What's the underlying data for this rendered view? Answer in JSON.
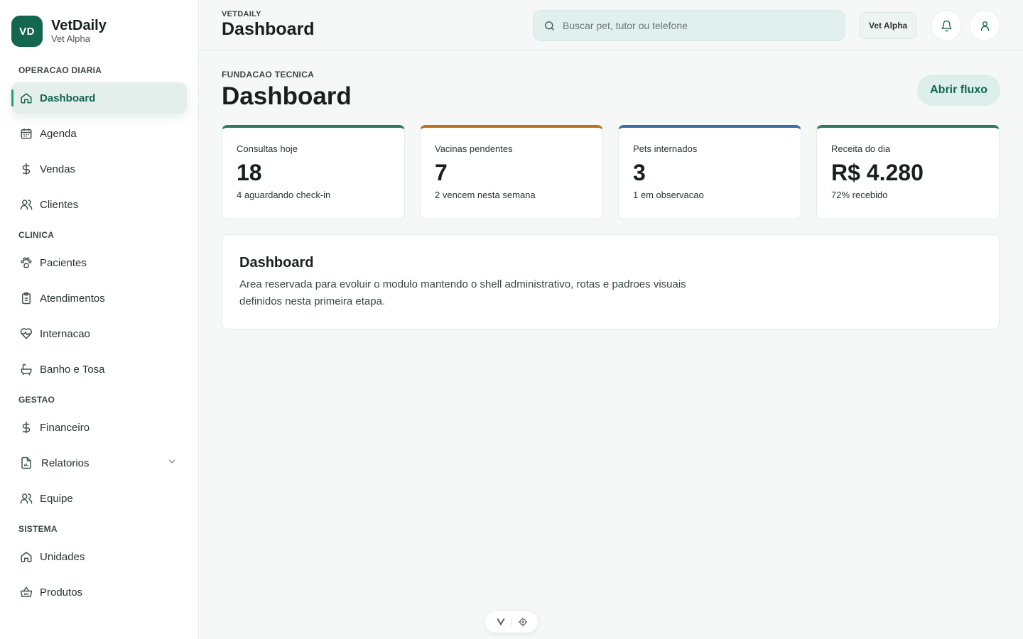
{
  "brand": {
    "initials": "VD",
    "name": "VetDaily",
    "unit": "Vet Alpha"
  },
  "sidebar": {
    "groups": [
      {
        "title": "OPERACAO DIARIA",
        "items": [
          {
            "label": "Dashboard",
            "icon": "home-icon"
          },
          {
            "label": "Agenda",
            "icon": "calendar-icon"
          },
          {
            "label": "Vendas",
            "icon": "dollar-icon"
          },
          {
            "label": "Clientes",
            "icon": "users-icon"
          }
        ]
      },
      {
        "title": "CLINICA",
        "items": [
          {
            "label": "Pacientes",
            "icon": "paw-icon"
          },
          {
            "label": "Atendimentos",
            "icon": "clipboard-icon"
          },
          {
            "label": "Internacao",
            "icon": "heart-pulse-icon"
          },
          {
            "label": "Banho e Tosa",
            "icon": "bath-icon"
          }
        ]
      },
      {
        "title": "GESTAO",
        "items": [
          {
            "label": "Financeiro",
            "icon": "dollar-icon"
          },
          {
            "label": "Relatorios",
            "icon": "report-icon"
          },
          {
            "label": "Equipe",
            "icon": "users-icon"
          }
        ]
      },
      {
        "title": "SISTEMA",
        "items": [
          {
            "label": "Unidades",
            "icon": "home-icon"
          },
          {
            "label": "Produtos",
            "icon": "basket-icon"
          }
        ]
      }
    ]
  },
  "topbar": {
    "eyebrow": "VETDAILY",
    "title": "Dashboard",
    "search_placeholder": "Buscar pet, tutor ou telefone",
    "unit_label": "Vet Alpha"
  },
  "page": {
    "eyebrow": "FUNDACAO TECNICA",
    "title": "Dashboard",
    "action_label": "Abrir fluxo"
  },
  "stats": [
    {
      "label": "Consultas hoje",
      "value": "18",
      "note": "4 aguardando check-in",
      "accent": "#2f7a5f"
    },
    {
      "label": "Vacinas pendentes",
      "value": "7",
      "note": "2 vencem nesta semana",
      "accent": "#b8741f"
    },
    {
      "label": "Pets internados",
      "value": "3",
      "note": "1 em observacao",
      "accent": "#3b6ea5"
    },
    {
      "label": "Receita do dia",
      "value": "R$ 4.280",
      "note": "72% recebido",
      "accent": "#2f7a5f"
    }
  ],
  "panel": {
    "title": "Dashboard",
    "text": "Area reservada para evoluir o modulo mantendo o shell administrativo, rotas e padroes visuais definidos nesta primeira etapa."
  },
  "colors": {
    "brand": "#14664f",
    "active_bg": "#e4efec",
    "background": "#f5f8f7"
  }
}
